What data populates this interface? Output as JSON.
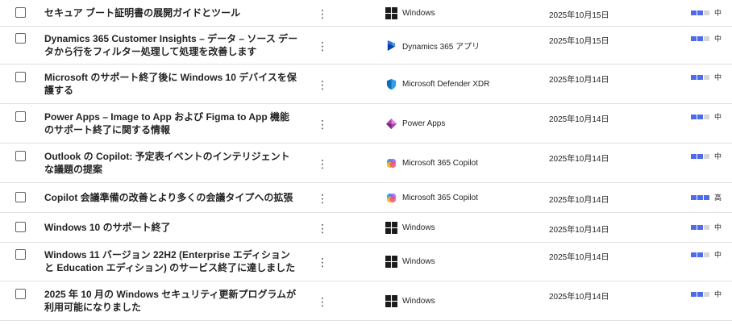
{
  "rows": [
    {
      "title": "セキュア ブート証明書の展開ガイドとツール",
      "product": "Windows",
      "product_icon": "windows-icon",
      "date": "2025年10月15日",
      "severity": "中",
      "severity_level": 2
    },
    {
      "title": "Dynamics 365 Customer Insights – データ – ソース データから行をフィルター処理して処理を改善します",
      "product": "Dynamics 365 アプリ",
      "product_icon": "dynamics-365-icon",
      "date": "2025年10月15日",
      "severity": "中",
      "severity_level": 2
    },
    {
      "title": "Microsoft のサポート終了後に Windows 10 デバイスを保護する",
      "product": "Microsoft Defender XDR",
      "product_icon": "defender-shield-icon",
      "date": "2025年10月14日",
      "severity": "中",
      "severity_level": 2
    },
    {
      "title": "Power Apps – Image to App および Figma to App 機能のサポート終了に関する情報",
      "product": "Power Apps",
      "product_icon": "power-apps-icon",
      "date": "2025年10月14日",
      "severity": "中",
      "severity_level": 2
    },
    {
      "title": "Outlook の Copilot: 予定表イベントのインテリジェントな議題の提案",
      "product": "Microsoft 365 Copilot",
      "product_icon": "copilot-icon",
      "date": "2025年10月14日",
      "severity": "中",
      "severity_level": 2
    },
    {
      "title": "Copilot 会議準備の改善とより多くの会議タイプへの拡張",
      "product": "Microsoft 365 Copilot",
      "product_icon": "copilot-icon",
      "date": "2025年10月14日",
      "severity": "高",
      "severity_level": 3
    },
    {
      "title": "Windows 10 のサポート終了",
      "product": "Windows",
      "product_icon": "windows-icon",
      "date": "2025年10月14日",
      "severity": "中",
      "severity_level": 2
    },
    {
      "title": "Windows 11 バージョン 22H2 (Enterprise エディションと Education エディション) のサービス終了に達しました",
      "product": "Windows",
      "product_icon": "windows-icon",
      "date": "2025年10月14日",
      "severity": "中",
      "severity_level": 2
    },
    {
      "title": "2025 年 10 月の Windows セキュリティ更新プログラムが利用可能になりました",
      "product": "Windows",
      "product_icon": "windows-icon",
      "date": "2025年10月14日",
      "severity": "中",
      "severity_level": 2
    }
  ],
  "more_glyph": "⋮",
  "colors": {
    "severity_on": "#4f6bed",
    "severity_off": "#d6d6d6",
    "divider": "#e1e1e1"
  }
}
